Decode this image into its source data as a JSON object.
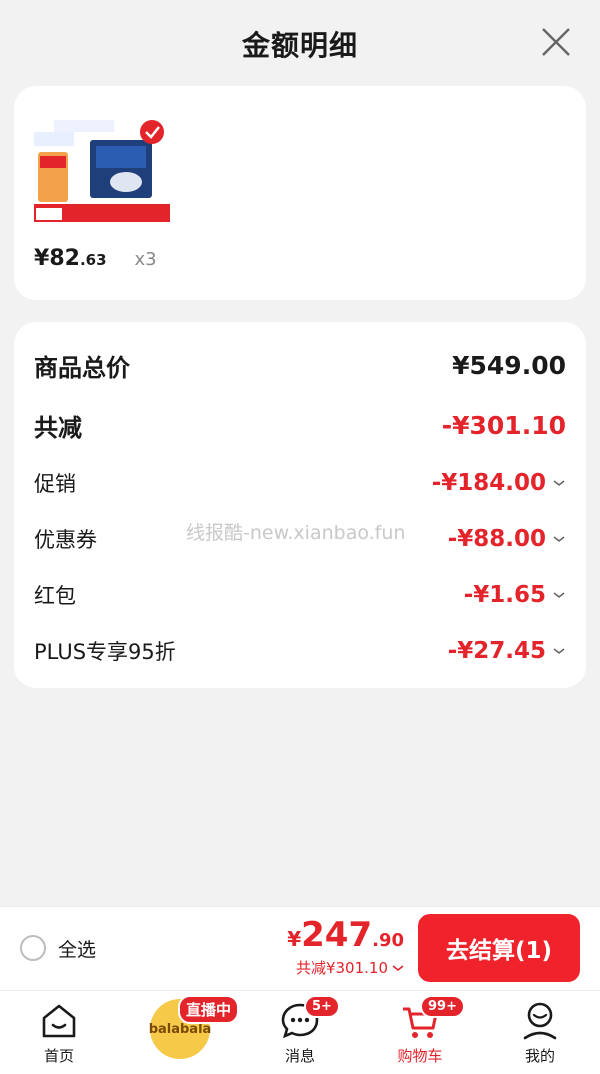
{
  "header": {
    "title": "金额明细"
  },
  "product": {
    "price_yen": "¥",
    "price_int": "82",
    "price_dec": ".63",
    "quantity": "x3"
  },
  "detail": {
    "total_label": "商品总价",
    "total_value": "¥549.00",
    "reduce_label": "共减",
    "reduce_value": "-¥301.10",
    "items": [
      {
        "label": "促销",
        "value": "-¥184.00"
      },
      {
        "label": "优惠券",
        "value": "-¥88.00"
      },
      {
        "label": "红包",
        "value": "-¥1.65"
      },
      {
        "label": "PLUS专享95折",
        "value": "-¥27.45"
      }
    ]
  },
  "watermark": "线报酷-new.xianbao.fun",
  "checkout": {
    "select_all": "全选",
    "total_yen": "¥",
    "total_int": "247",
    "total_dec": ".90",
    "discount": "共减¥301.10",
    "pay_button": "去结算(1)"
  },
  "tabbar": {
    "home": "首页",
    "live_logo": "balabala",
    "live_badge": "直播中",
    "messages": "消息",
    "messages_badge": "5+",
    "cart": "购物车",
    "cart_badge": "99+",
    "mine": "我的"
  },
  "colors": {
    "accent": "#e4242b",
    "button": "#f0222c"
  }
}
